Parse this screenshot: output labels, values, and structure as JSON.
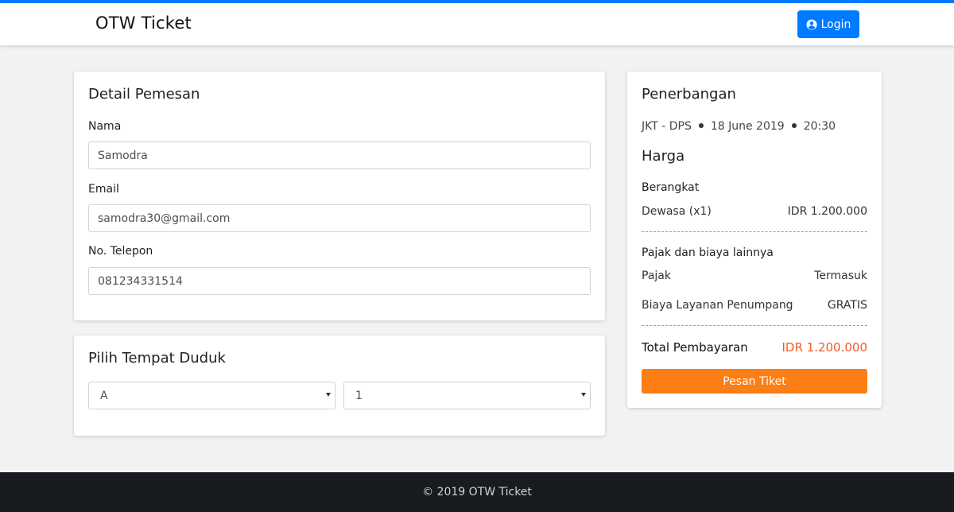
{
  "header": {
    "brand": "OTW Ticket",
    "login_label": "Login",
    "login_icon": "user-circle-icon",
    "accent_color": "#007bff"
  },
  "booker": {
    "title": "Detail Pemesan",
    "name_label": "Nama",
    "name_value": "Samodra",
    "email_label": "Email",
    "email_value": "samodra30@gmail.com",
    "phone_label": "No. Telepon",
    "phone_value": "081234331514"
  },
  "seat": {
    "title": "Pilih Tempat Duduk",
    "row_value": "A",
    "number_value": "1"
  },
  "flight": {
    "title": "Penerbangan",
    "route": "JKT - DPS",
    "date": "18 June 2019",
    "time": "20:30"
  },
  "price": {
    "title": "Harga",
    "departure_label": "Berangkat",
    "adult_label": "Dewasa (x1)",
    "adult_value": "IDR 1.200.000",
    "tax_section_label": "Pajak dan biaya lainnya",
    "tax_label": "Pajak",
    "tax_value": "Termasuk",
    "service_label": "Biaya Layanan Penumpang",
    "service_value": "GRATIS",
    "total_label": "Total Pembayaran",
    "total_value": "IDR 1.200.000",
    "total_color": "#f05a28",
    "order_label": "Pesan Tiket",
    "order_color": "#fd7e14"
  },
  "footer": {
    "text": "© 2019 OTW Ticket"
  }
}
